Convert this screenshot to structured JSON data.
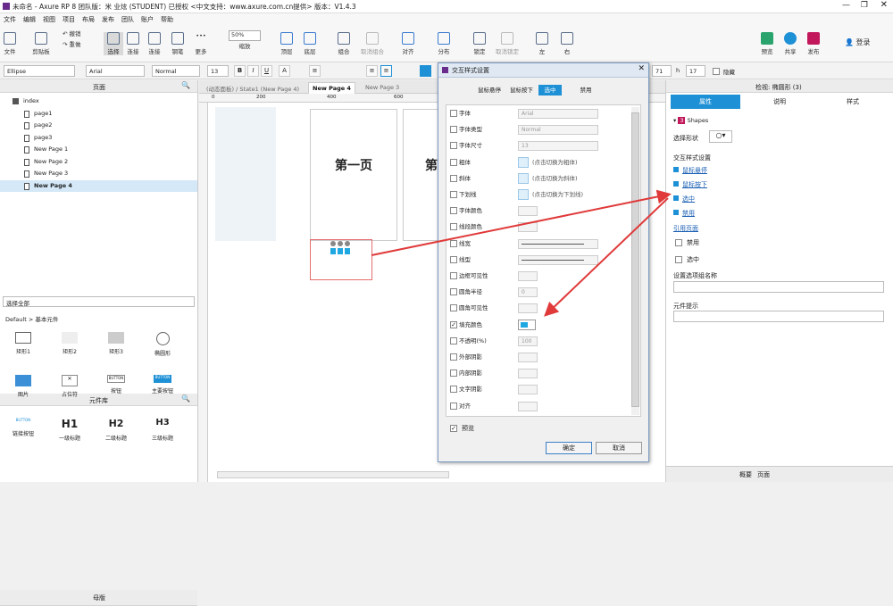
{
  "window": {
    "title": "未命名 - Axure RP 8 团队版：米 业炫 (STUDENT) 已授权     <中文支持：www.axure.com.cn提供> 版本：V1.4.3"
  },
  "menu": [
    "文件",
    "编辑",
    "视图",
    "项目",
    "布局",
    "发布",
    "团队",
    "账户",
    "帮助"
  ],
  "toolbar": {
    "file": "文件",
    "clipboard": "剪贴板",
    "select": "选择",
    "connect": "连接",
    "pen": "钢笔",
    "more": "更多",
    "undo": "撤销",
    "redo": "重做",
    "zoom": "50%",
    "zoom_label": "缩放",
    "top": "顶层",
    "bottom": "底层",
    "group": "组合",
    "ungroup": "取消组合",
    "align": "对齐",
    "distribute": "分布",
    "lock": "锁定",
    "unlock": "取消锁定",
    "left": "左",
    "right": "右",
    "preview": "预览",
    "share": "共享",
    "publish": "发布",
    "login": "登录"
  },
  "format": {
    "shape": "Ellipse",
    "font": "Arial",
    "weight": "Normal",
    "size": "13",
    "x": "71",
    "h_label": "h",
    "h": "17",
    "hidden": "隐藏"
  },
  "pages": {
    "header": "页面",
    "items": [
      "index",
      "page1",
      "page2",
      "page3",
      "New Page 1",
      "New Page 2",
      "New Page 3",
      "New Page 4"
    ]
  },
  "library": {
    "header": "元件库",
    "select_all": "选择全部",
    "group": "Default > 基本元件",
    "widgets": [
      "矩形1",
      "矩形2",
      "矩形3",
      "椭圆形",
      "图片",
      "占位符",
      "按钮",
      "主要按钮",
      "链接按钮",
      "一级标题",
      "二级标题",
      "三级标题"
    ],
    "btn": "BUTTON",
    "h1": "H1",
    "h2": "H2",
    "h3": "H3"
  },
  "masters": {
    "header": "母版"
  },
  "tabs": [
    "(动态面板) / State1 (New Page 4)",
    "New Page 4",
    "New Page 3"
  ],
  "ruler": [
    "0",
    "200",
    "400",
    "600"
  ],
  "canvas": {
    "card1": "第一页",
    "card2": "第"
  },
  "dialog": {
    "title": "交互样式设置",
    "tabs": [
      "鼠标悬停",
      "鼠标按下",
      "选中",
      "禁用"
    ],
    "rows": [
      {
        "label": "字体",
        "value": "Arial",
        "checked": false
      },
      {
        "label": "字体类型",
        "value": "Normal",
        "checked": false
      },
      {
        "label": "字体尺寸",
        "value": "13",
        "checked": false
      },
      {
        "label": "粗体",
        "value": "(点击切换为粗体)",
        "checked": false
      },
      {
        "label": "斜体",
        "value": "(点击切换为斜体)",
        "checked": false
      },
      {
        "label": "下划线",
        "value": "(点击切换为下划线)",
        "checked": false
      },
      {
        "label": "字体颜色",
        "value": "",
        "checked": false
      },
      {
        "label": "线段颜色",
        "value": "",
        "checked": false
      },
      {
        "label": "线宽",
        "value": "",
        "checked": false
      },
      {
        "label": "线型",
        "value": "",
        "checked": false
      },
      {
        "label": "边框可见性",
        "value": "",
        "checked": false
      },
      {
        "label": "圆角半径",
        "value": "0",
        "checked": false
      },
      {
        "label": "圆角可见性",
        "value": "",
        "checked": false
      },
      {
        "label": "填充颜色",
        "value": "",
        "checked": true
      },
      {
        "label": "不透明(%)",
        "value": "100",
        "checked": false
      },
      {
        "label": "外部阴影",
        "value": "",
        "checked": false
      },
      {
        "label": "内部阴影",
        "value": "",
        "checked": false
      },
      {
        "label": "文字阴影",
        "value": "",
        "checked": false
      },
      {
        "label": "对齐",
        "value": "",
        "checked": false
      }
    ],
    "preview": "预览",
    "ok": "确定",
    "cancel": "取消"
  },
  "right": {
    "header": "检视: 椭圆形 (3)",
    "tabs": [
      "属性",
      "说明",
      "样式"
    ],
    "shapes_badge": "3",
    "shapes": "Shapes",
    "select_shape": "选择形状",
    "interaction": "交互样式设置",
    "links": [
      "鼠标悬停",
      "鼠标按下",
      "选中",
      "禁用"
    ],
    "ref_page": "引用页面",
    "disabled": "禁用",
    "selected": "选中",
    "group_name": "设置选项组名称",
    "tooltip": "元件提示",
    "footer_left": "概要",
    "footer_right": "页面"
  },
  "colors": {
    "accent": "#1e90d6",
    "fill": "#1ea7e0",
    "arrow": "#e03a3a"
  }
}
